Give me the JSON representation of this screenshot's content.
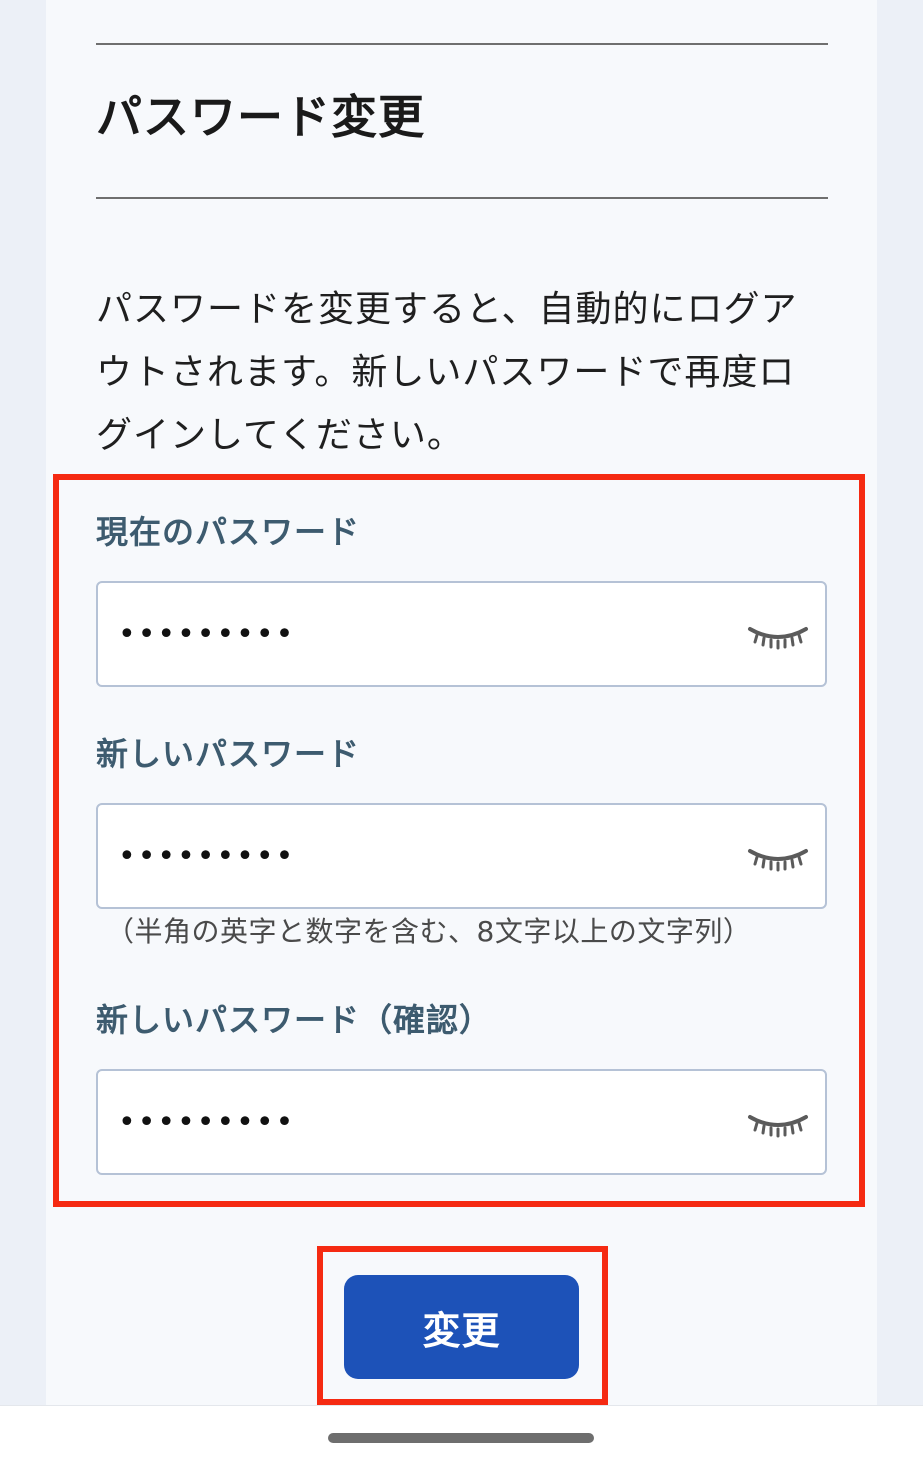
{
  "page": {
    "title": "パスワード変更",
    "description": "パスワードを変更すると、自動的にログアウトされます。新しいパスワードで再度ログインしてください。"
  },
  "fields": {
    "current": {
      "label": "現在のパスワード",
      "value": "•••••••••"
    },
    "new": {
      "label": "新しいパスワード",
      "value": "•••••••••",
      "hint": "（半角の英字と数字を含む、8文字以上の文字列）"
    },
    "confirm": {
      "label": "新しいパスワード（確認）",
      "value": "•••••••••"
    }
  },
  "submit": {
    "label": "変更"
  },
  "icons": {
    "toggle": "eye-closed-icon"
  },
  "colors": {
    "primary": "#1d52b8",
    "highlight": "#f52a12",
    "label": "#3d5b6f",
    "background": "#ecf0f7",
    "card": "#f7f9fc"
  }
}
